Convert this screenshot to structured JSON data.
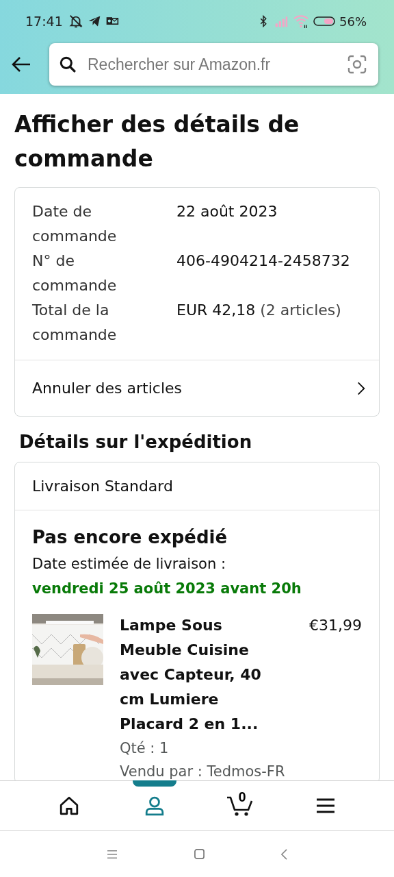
{
  "status_bar": {
    "time": "17:41",
    "battery": "56%"
  },
  "header": {
    "search": {
      "placeholder": "Rechercher sur Amazon.fr"
    }
  },
  "title": "Afficher des détails de commande",
  "order_summary": {
    "rows": [
      {
        "label": "Date de commande",
        "value": "22 août 2023"
      },
      {
        "label": "N° de commande",
        "value": "406-4904214-2458732"
      },
      {
        "label": "Total de la commande",
        "value": "EUR 42,18",
        "note": "(2 articles)"
      }
    ],
    "action": "Annuler des articles"
  },
  "shipping": {
    "heading": "Détails sur l'expédition",
    "method": "Livraison Standard",
    "status": "Pas encore expédié",
    "estimate_label": "Date estimée de livraison :",
    "estimate": "vendredi 25 août 2023 avant 20h",
    "items": [
      {
        "title": "Lampe Sous Meuble Cuisine avec Capteur, 40 cm Lumiere Placard 2 en 1...",
        "price": "€31,99",
        "quantity": "Qté : 1",
        "seller": "Vendu par : Tedmos-FR"
      }
    ]
  },
  "bottom_nav": [
    {
      "kind": "home",
      "selected": false
    },
    {
      "kind": "account",
      "selected": true
    },
    {
      "kind": "cart",
      "count": "0",
      "selected": false
    },
    {
      "kind": "menu",
      "selected": false
    }
  ]
}
